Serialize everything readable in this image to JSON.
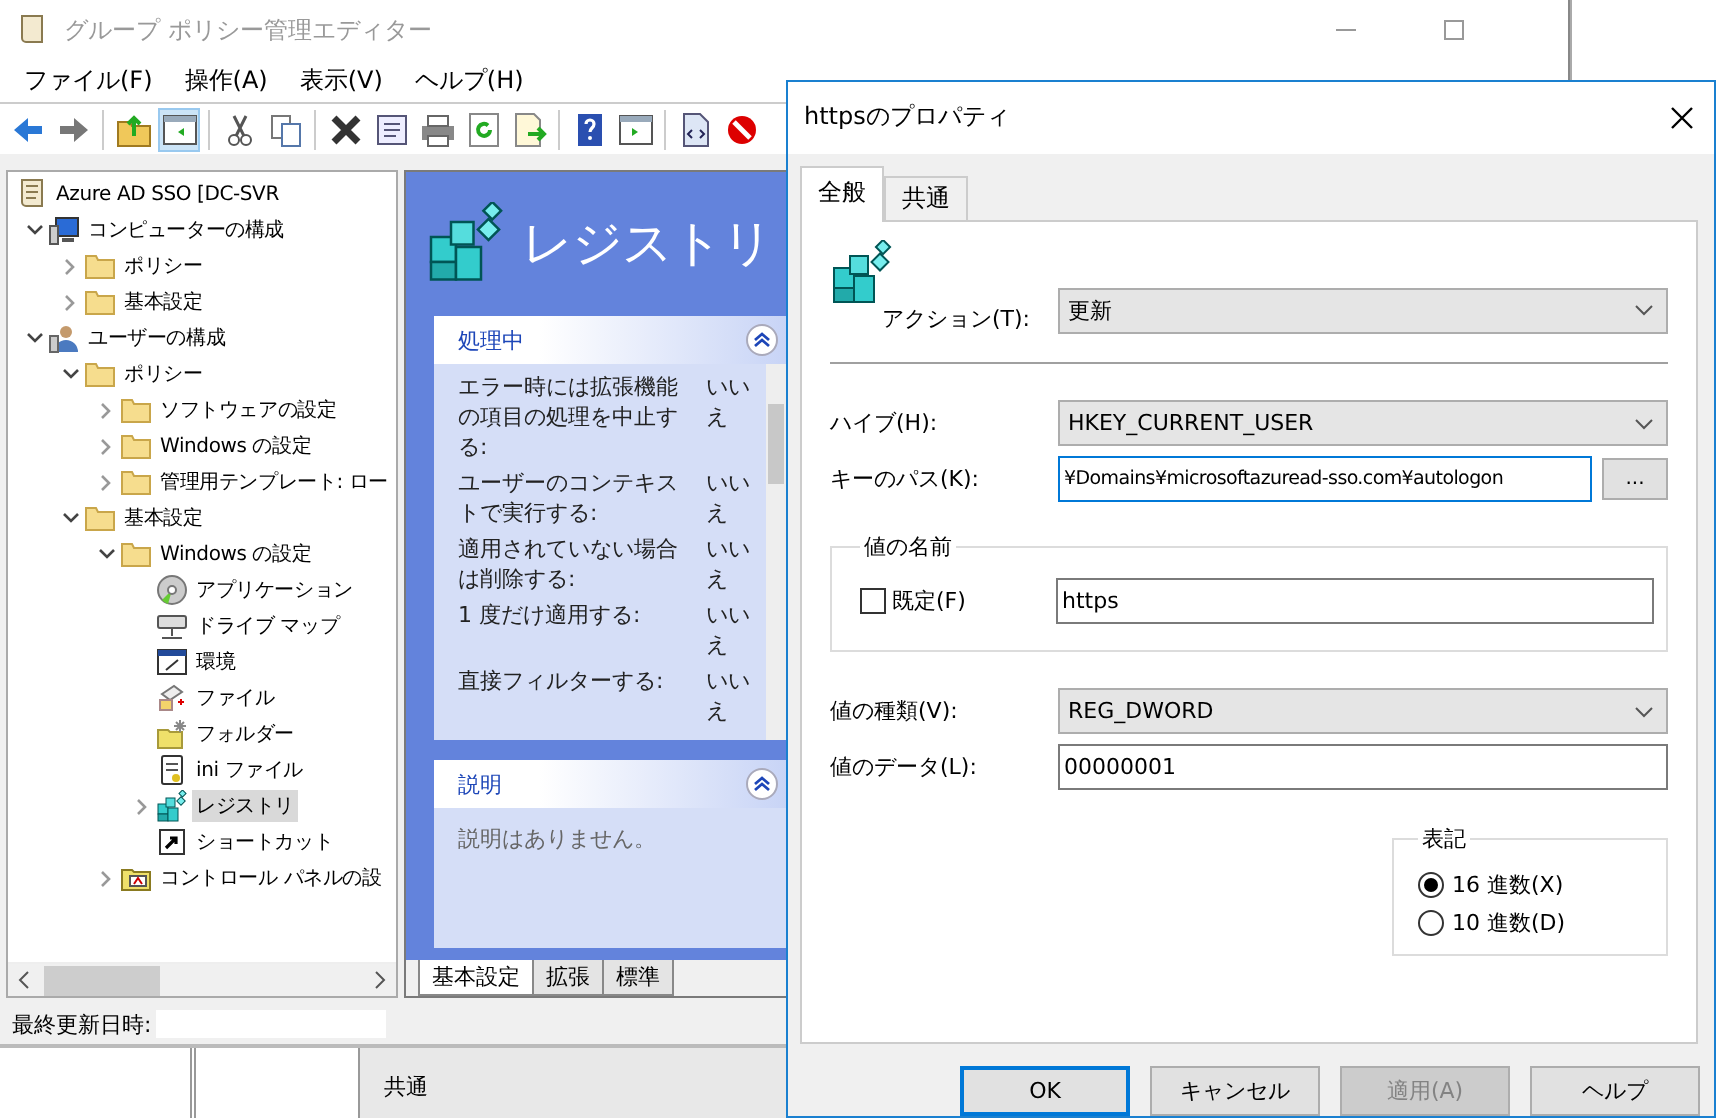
{
  "window": {
    "title": "グループ ポリシー管理エディター"
  },
  "menu": [
    "ファイル(F)",
    "操作(A)",
    "表示(V)",
    "ヘルプ(H)"
  ],
  "toolbar": [
    [
      {
        "kind": "back",
        "pressed": false
      },
      {
        "kind": "forward",
        "pressed": false
      }
    ],
    [
      {
        "kind": "up",
        "pressed": false
      },
      {
        "kind": "pane",
        "pressed": true
      }
    ],
    [
      {
        "kind": "cut",
        "pressed": false
      },
      {
        "kind": "copy",
        "pressed": false
      }
    ],
    [
      {
        "kind": "delete",
        "pressed": false
      },
      {
        "kind": "props",
        "pressed": false
      },
      {
        "kind": "print",
        "pressed": false
      },
      {
        "kind": "refresh",
        "pressed": false
      },
      {
        "kind": "export",
        "pressed": false
      }
    ],
    [
      {
        "kind": "help",
        "pressed": false
      },
      {
        "kind": "pane2",
        "pressed": false
      }
    ],
    [
      {
        "kind": "xml",
        "pressed": false
      },
      {
        "kind": "stop",
        "pressed": false
      }
    ]
  ],
  "tree": [
    {
      "label": "Azure AD SSO [DC-SVR",
      "kind": "scroll",
      "selected": false,
      "children": [
        {
          "label": "コンピューターの構成",
          "kind": "computer",
          "expanded": true,
          "selected": false,
          "children": [
            {
              "label": "ポリシー",
              "kind": "folder",
              "expanded": false,
              "selected": false
            },
            {
              "label": "基本設定",
              "kind": "folder",
              "expanded": false,
              "selected": false
            }
          ]
        },
        {
          "label": "ユーザーの構成",
          "kind": "user",
          "expanded": true,
          "selected": false,
          "children": [
            {
              "label": "ポリシー",
              "kind": "folder",
              "expanded": true,
              "selected": false,
              "children": [
                {
                  "label": "ソフトウェアの設定",
                  "kind": "folder",
                  "expanded": false,
                  "selected": false
                },
                {
                  "label": "Windows の設定",
                  "kind": "folder",
                  "expanded": false,
                  "selected": false
                },
                {
                  "label": "管理用テンプレート: ロー",
                  "kind": "folder",
                  "expanded": false,
                  "selected": false
                }
              ]
            },
            {
              "label": "基本設定",
              "kind": "folder",
              "expanded": true,
              "selected": false,
              "children": [
                {
                  "label": "Windows の設定",
                  "kind": "folder",
                  "expanded": true,
                  "selected": false,
                  "children": [
                    {
                      "label": "アプリケーション",
                      "kind": "disc",
                      "selected": false
                    },
                    {
                      "label": "ドライブ マップ",
                      "kind": "drive",
                      "selected": false
                    },
                    {
                      "label": "環境",
                      "kind": "env",
                      "selected": false
                    },
                    {
                      "label": "ファイル",
                      "kind": "file",
                      "selected": false
                    },
                    {
                      "label": "フォルダー",
                      "kind": "newfolder",
                      "selected": false
                    },
                    {
                      "label": "ini ファイル",
                      "kind": "ini",
                      "selected": false
                    },
                    {
                      "label": "レジストリ",
                      "kind": "registry",
                      "expanded": false,
                      "selected": true
                    },
                    {
                      "label": "ショートカット",
                      "kind": "shortcut",
                      "selected": false
                    }
                  ]
                },
                {
                  "label": "コントロール パネルの設",
                  "kind": "control",
                  "expanded": false,
                  "selected": false
                }
              ]
            }
          ]
        }
      ]
    }
  ],
  "pane": {
    "heading": "レジストリ",
    "sections": [
      {
        "title": "処理中",
        "expanded": true,
        "rows": [
          {
            "label": "エラー時には拡張機能の項目の処理を中止する:",
            "value": "いいえ"
          },
          {
            "label": "ユーザーのコンテキストで実行する:",
            "value": "いいえ"
          },
          {
            "label": "適用されていない場合は削除する:",
            "value": "いいえ"
          },
          {
            "label": "1 度だけ適用する:",
            "value": "いいえ"
          },
          {
            "label": "直接フィルターする:",
            "value": "いいえ"
          }
        ]
      },
      {
        "title": "説明",
        "expanded": true,
        "text": "説明はありません。"
      }
    ],
    "tabs": [
      {
        "label": "基本設定",
        "selected": true
      },
      {
        "label": "拡張",
        "selected": false
      },
      {
        "label": "標準",
        "selected": false
      }
    ]
  },
  "status_bar": {
    "label": "最終更新日時:"
  },
  "background_window": {
    "header": "共通"
  },
  "dialog": {
    "title": "httpsのプロパティ",
    "tabs": [
      {
        "label": "全般",
        "selected": true
      },
      {
        "label": "共通",
        "selected": false
      }
    ],
    "action": {
      "label": "アクション(T):",
      "value": "更新"
    },
    "hive": {
      "label": "ハイブ(H):",
      "value": "HKEY_CURRENT_USER"
    },
    "key_path": {
      "label": "キーのパス(K):",
      "value": "¥Domains¥microsoftazuread-sso.com¥autologon",
      "focused": true,
      "browse": "..."
    },
    "value_name": {
      "legend": "値の名前",
      "default": {
        "label": "既定(F)",
        "checked": false
      },
      "value": "https"
    },
    "value_type": {
      "label": "値の種類(V):",
      "value": "REG_DWORD"
    },
    "value_data": {
      "label": "値のデータ(L):",
      "value": "00000001"
    },
    "base": {
      "legend": "表記",
      "options": [
        {
          "label": "16 進数(X)",
          "selected": true
        },
        {
          "label": "10 進数(D)",
          "selected": false
        }
      ]
    },
    "buttons": [
      {
        "label": "OK",
        "default": true,
        "disabled": false
      },
      {
        "label": "キャンセル",
        "default": false,
        "disabled": false
      },
      {
        "label": "適用(A)",
        "default": false,
        "disabled": true
      },
      {
        "label": "ヘルプ",
        "default": false,
        "disabled": false
      }
    ]
  }
}
